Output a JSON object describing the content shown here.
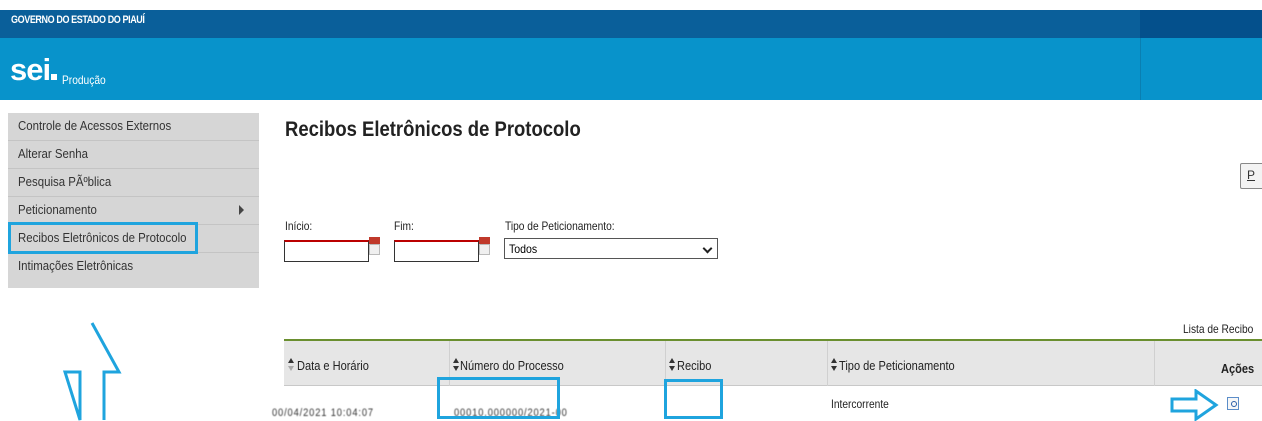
{
  "header": {
    "gov_title": "GOVERNO DO ESTADO DO PIAUÍ",
    "logo": "sei",
    "environment": "Produção"
  },
  "sidebar": {
    "items": [
      {
        "label": "Controle de Acessos Externos"
      },
      {
        "label": "Alterar Senha"
      },
      {
        "label": "Pesquisa PÃºblica"
      },
      {
        "label": "Peticionamento",
        "has_submenu": true
      },
      {
        "label": "Recibos Eletrônicos de Protocolo",
        "highlighted": true
      },
      {
        "label": "Intimações Eletrônicas"
      }
    ]
  },
  "main": {
    "title": "Recibos Eletrônicos de Protocolo",
    "top_button_label": "P",
    "filters": {
      "inicio_label": "Início:",
      "inicio_value": "",
      "fim_label": "Fim:",
      "fim_value": "",
      "tipo_label": "Tipo de Peticionamento:",
      "tipo_selected": "Todos"
    },
    "list_caption": "Lista de Recibo",
    "table": {
      "columns": [
        "Data e Horário",
        "Número do Processo",
        "Recibo",
        "Tipo de Peticionamento",
        "Ações"
      ],
      "rows": [
        {
          "data": "00/04/2021 10:04:07",
          "processo": "00010.000000/2021-00",
          "recibo": "",
          "tipo": "Intercorrente",
          "acao_icon": "view-document-icon"
        }
      ]
    }
  },
  "colors": {
    "gov_bar": "#0a5f9a",
    "brand_bar": "#0893cb",
    "sidebar_bg": "#d6d6d6",
    "highlight": "#1fa4de",
    "table_rule": "#6a8f2f"
  }
}
